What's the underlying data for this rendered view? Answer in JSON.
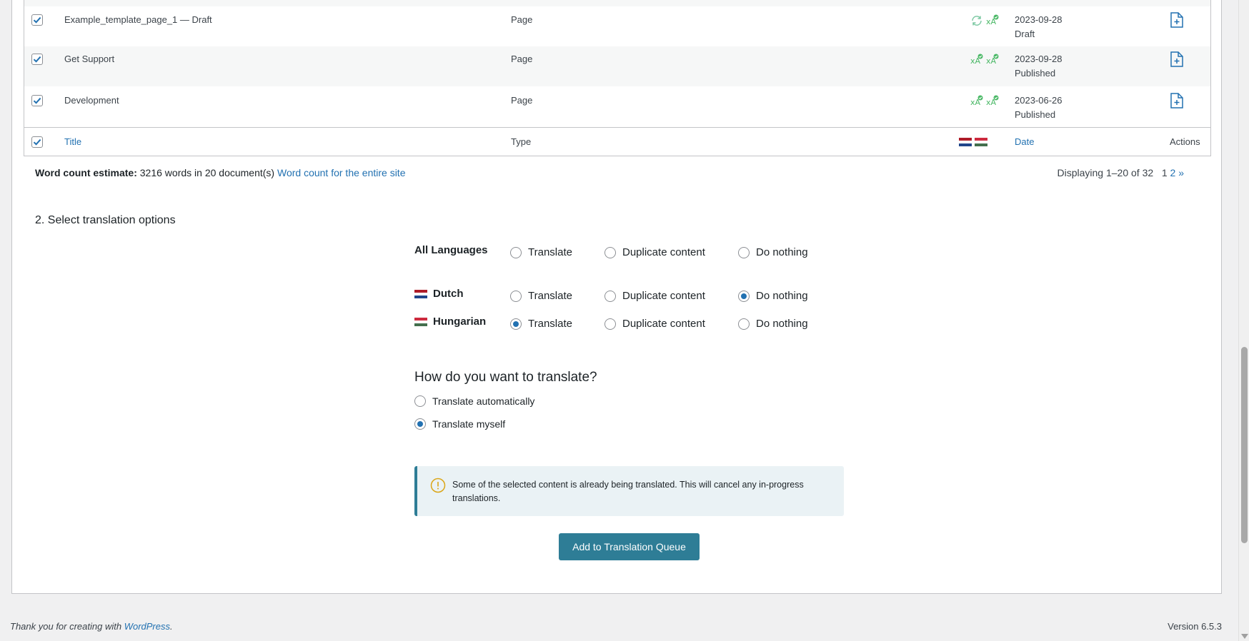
{
  "table": {
    "rows": [
      {
        "title": "Example_template_page_1 — Draft",
        "type": "Page",
        "date": "2023-09-28",
        "status": "Draft"
      },
      {
        "title": "Get Support",
        "type": "Page",
        "date": "2023-09-28",
        "status": "Published"
      },
      {
        "title": "Development",
        "type": "Page",
        "date": "2023-06-26",
        "status": "Published"
      }
    ],
    "footer": {
      "title": "Title",
      "type": "Type",
      "date": "Date",
      "actions": "Actions"
    }
  },
  "word_count": {
    "label": "Word count estimate:",
    "text": "3216 words in 20 document(s)",
    "link": "Word count for the entire site"
  },
  "pagination": {
    "displaying": "Displaying 1–20 of 32",
    "current": "1",
    "next_page": "2",
    "next": "»"
  },
  "translation_options": {
    "title": "2. Select translation options",
    "option_labels": {
      "translate": "Translate",
      "duplicate": "Duplicate content",
      "nothing": "Do nothing"
    },
    "languages": [
      {
        "name": "All Languages",
        "selected": null
      },
      {
        "name": "Dutch",
        "selected": "nothing"
      },
      {
        "name": "Hungarian",
        "selected": "translate"
      }
    ]
  },
  "how": {
    "title": "How do you want to translate?",
    "options": [
      "Translate automatically",
      "Translate myself"
    ],
    "selected": 1
  },
  "notice": {
    "text": "Some of the selected content is already being translated. This will cancel any in-progress translations."
  },
  "button": {
    "label": "Add to Translation Queue"
  },
  "footer": {
    "thanks": "Thank you for creating with",
    "wp": "WordPress",
    "period": ".",
    "version": "Version 6.5.3"
  },
  "colors": {
    "accent": "#2271b1",
    "button": "#2e7d96",
    "success": "#4ab866",
    "notice_bg": "#eaf2f5",
    "warning": "#dba617"
  }
}
